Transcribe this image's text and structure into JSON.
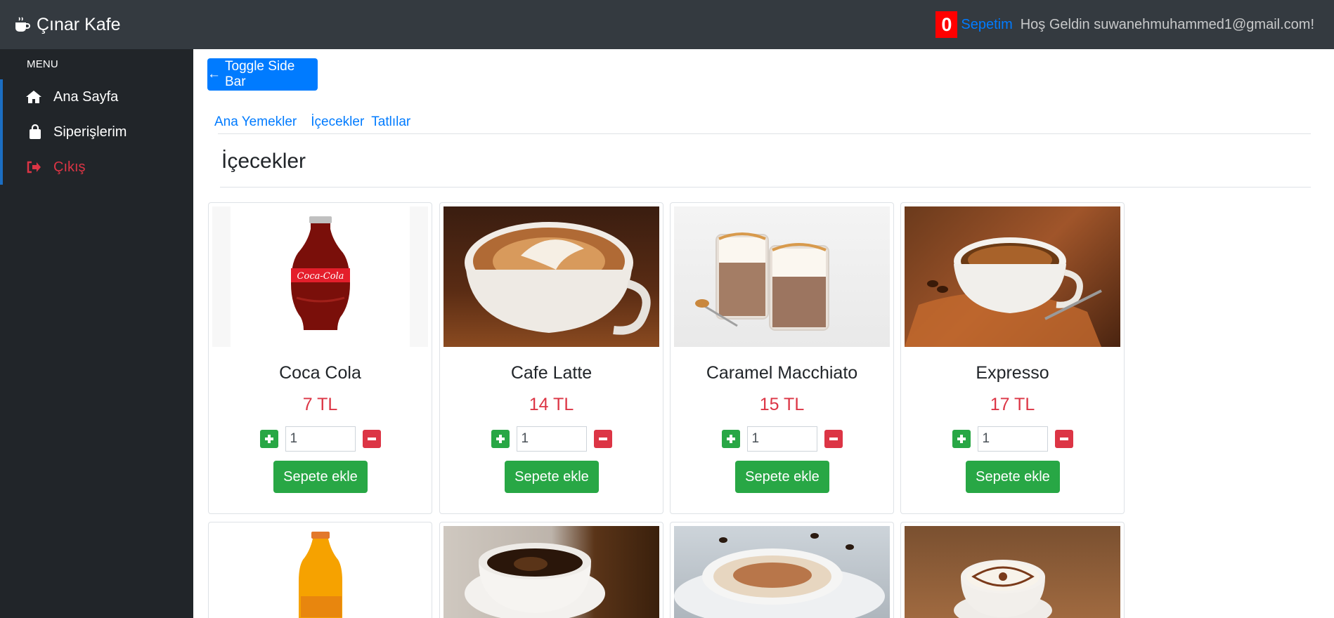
{
  "navbar": {
    "brand": "Çınar Kafe",
    "cart_count": "0",
    "cart_label": "Sepetim",
    "welcome": "Hoş Geldin suwanehmuhammed1@gmail.com!"
  },
  "sidebar": {
    "header": "MENU",
    "items": [
      {
        "label": "Ana Sayfa",
        "icon": "home-icon"
      },
      {
        "label": "Siperişlerim",
        "icon": "bag-icon"
      },
      {
        "label": "Çıkış",
        "icon": "sign-out-icon"
      }
    ]
  },
  "main": {
    "toggle_label": "Toggle Side Bar",
    "categories": [
      "Ana Yemekler",
      "İçecekler",
      "Tatlılar"
    ],
    "section_title": "İçecekler",
    "add_label": "Sepete ekle",
    "products": [
      {
        "name": "Coca Cola",
        "price": "7 TL",
        "qty": "1"
      },
      {
        "name": "Cafe Latte",
        "price": "14 TL",
        "qty": "1"
      },
      {
        "name": "Caramel Macchiato",
        "price": "15 TL",
        "qty": "1"
      },
      {
        "name": "Expresso",
        "price": "17 TL",
        "qty": "1"
      }
    ]
  },
  "colors": {
    "navbar": "#343a40",
    "sidebar": "#212529",
    "primary": "#007bff",
    "success": "#28a745",
    "danger": "#dc3545"
  }
}
